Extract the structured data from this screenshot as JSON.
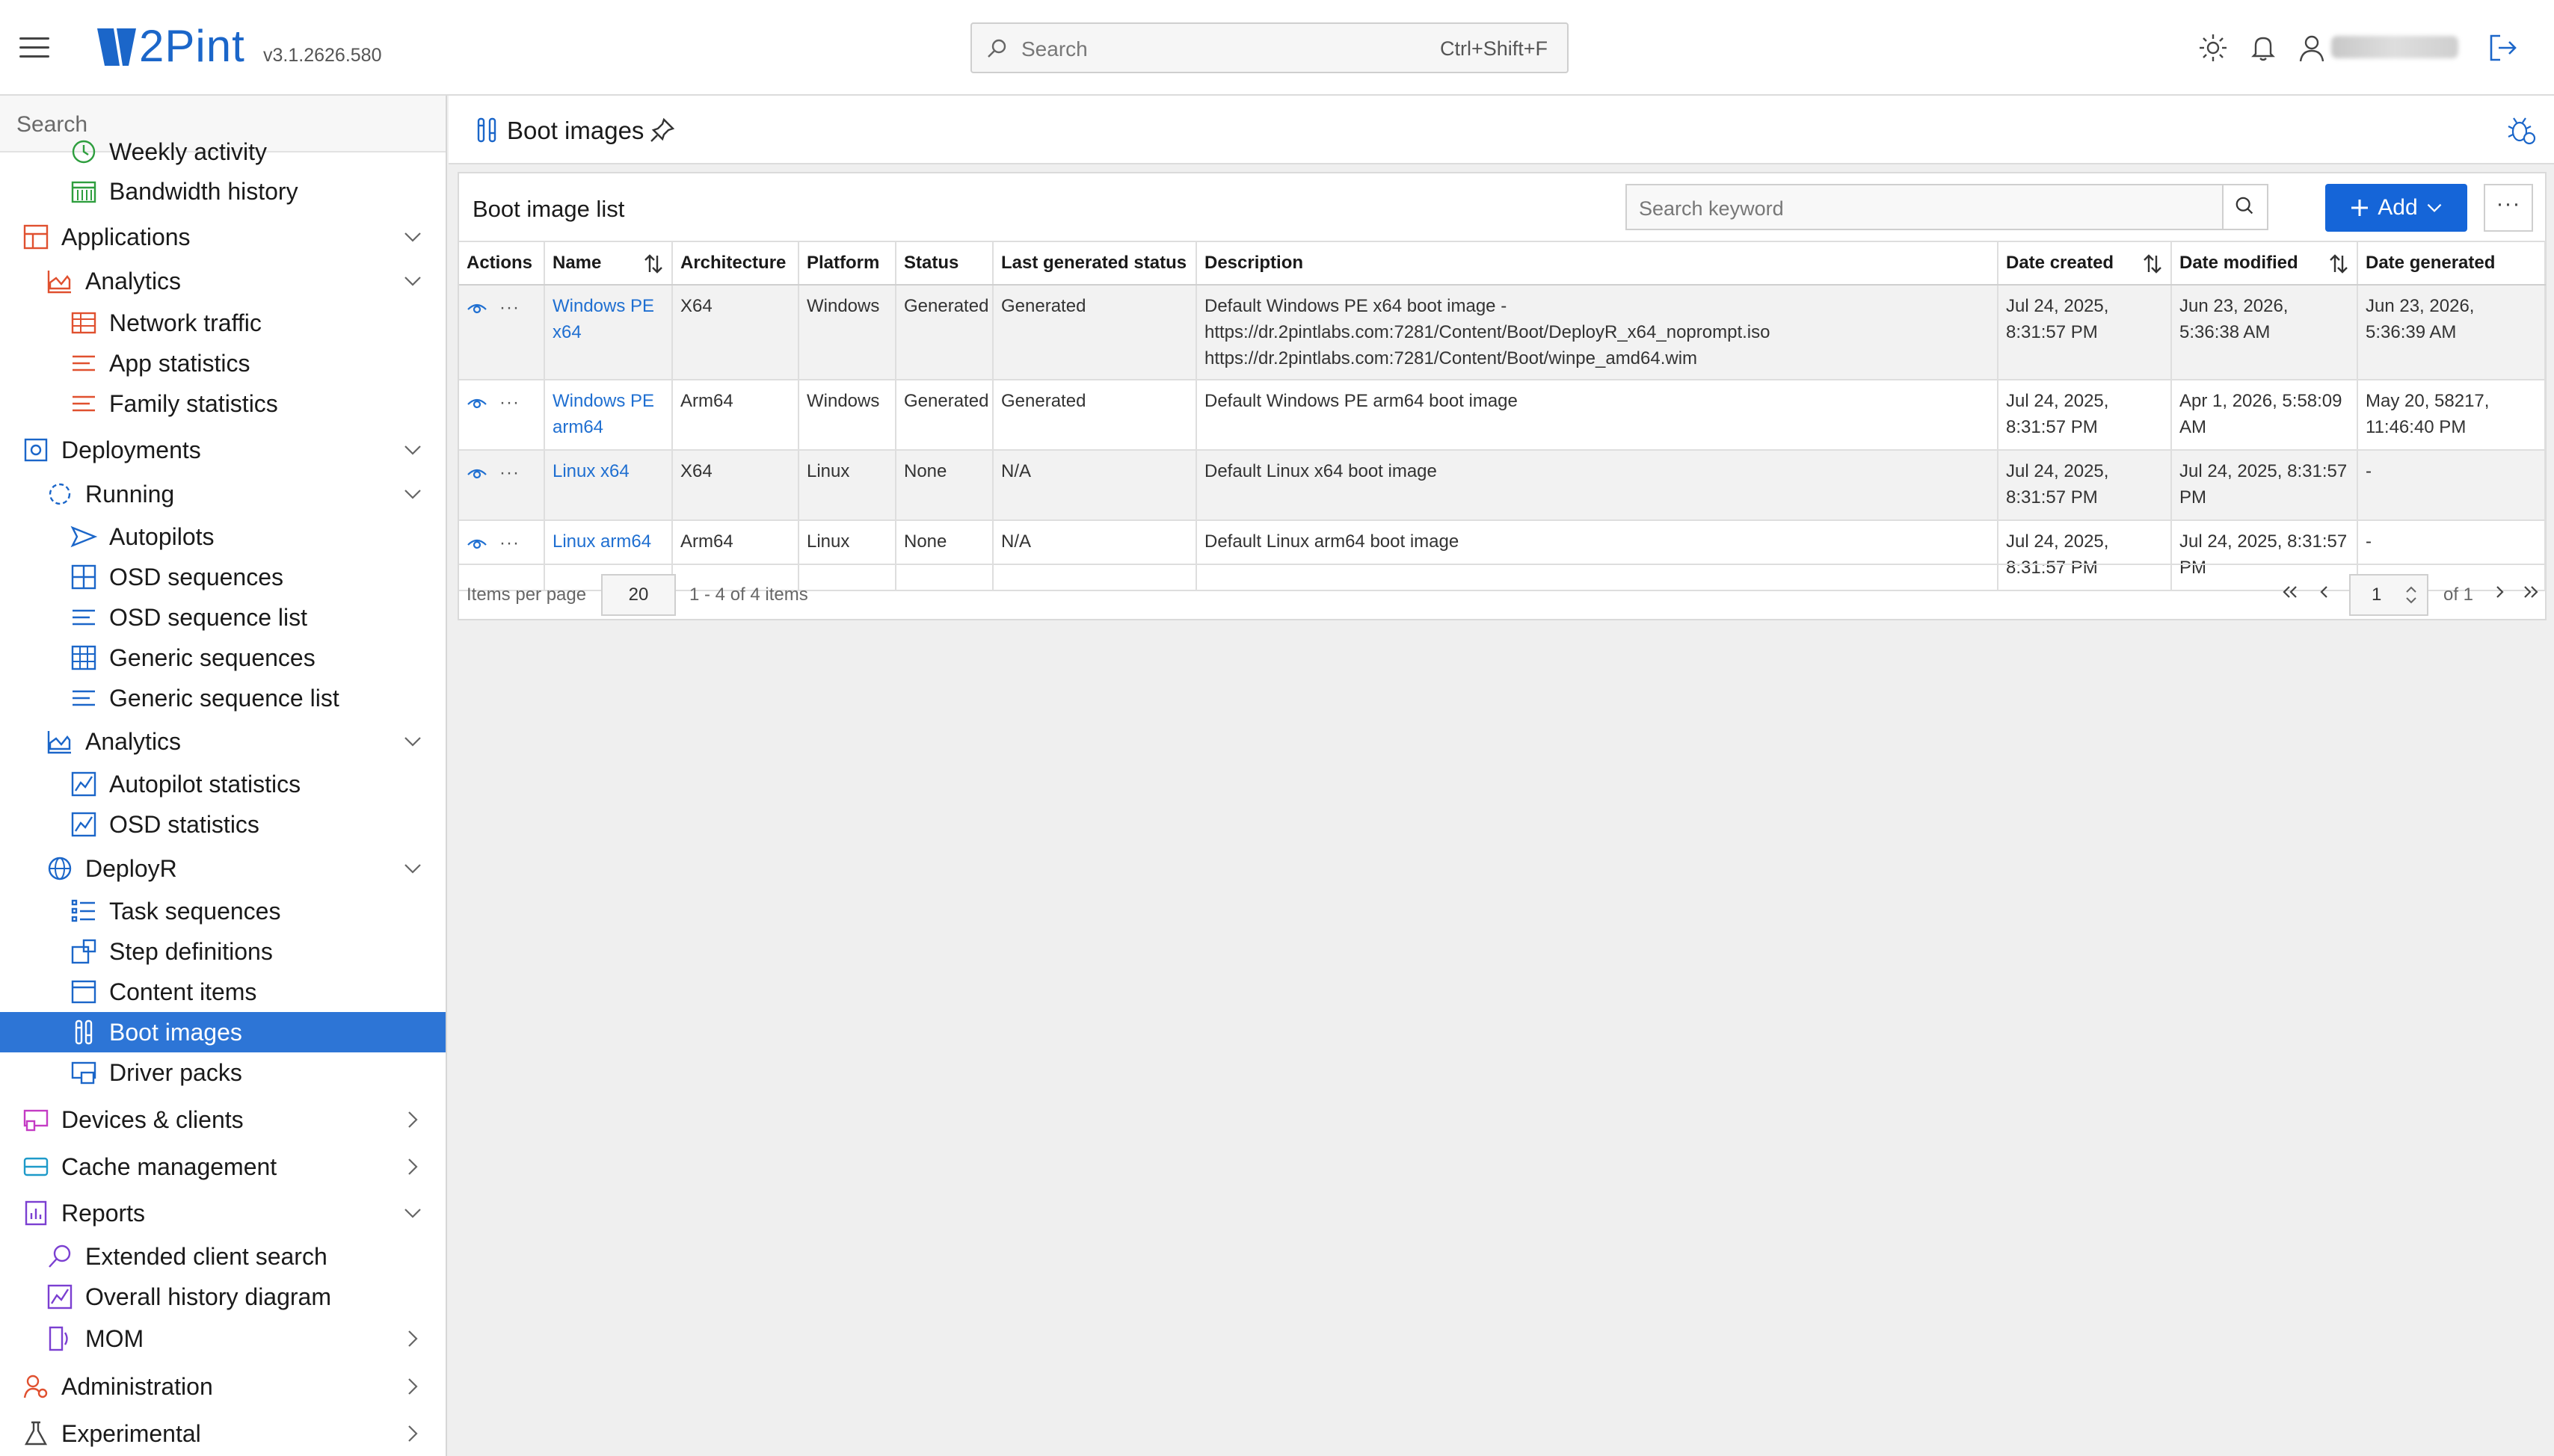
{
  "app": {
    "logo_text": "2Pint",
    "version": "v3.1.2626.580",
    "search_placeholder": "Search",
    "search_shortcut": "Ctrl+Shift+F"
  },
  "sidebar": {
    "search_placeholder": "Search",
    "items": [
      {
        "label": "Weekly activity"
      },
      {
        "label": "Bandwidth history"
      },
      {
        "label": "Applications"
      },
      {
        "label": "Analytics"
      },
      {
        "label": "Network traffic"
      },
      {
        "label": "App statistics"
      },
      {
        "label": "Family statistics"
      },
      {
        "label": "Deployments"
      },
      {
        "label": "Running"
      },
      {
        "label": "Autopilots"
      },
      {
        "label": "OSD sequences"
      },
      {
        "label": "OSD sequence list"
      },
      {
        "label": "Generic sequences"
      },
      {
        "label": "Generic sequence list"
      },
      {
        "label": "Analytics"
      },
      {
        "label": "Autopilot statistics"
      },
      {
        "label": "OSD statistics"
      },
      {
        "label": "DeployR"
      },
      {
        "label": "Task sequences"
      },
      {
        "label": "Step definitions"
      },
      {
        "label": "Content items"
      },
      {
        "label": "Boot images"
      },
      {
        "label": "Driver packs"
      },
      {
        "label": "Devices & clients"
      },
      {
        "label": "Cache management"
      },
      {
        "label": "Reports"
      },
      {
        "label": "Extended client search"
      },
      {
        "label": "Overall history diagram"
      },
      {
        "label": "MOM"
      },
      {
        "label": "Administration"
      },
      {
        "label": "Experimental"
      }
    ],
    "active_item": "Boot images"
  },
  "page": {
    "title": "Boot images"
  },
  "list": {
    "title": "Boot image list",
    "search_placeholder": "Search keyword",
    "add_label": "Add",
    "more_label": "···",
    "columns": [
      "Actions",
      "Name",
      "Architecture",
      "Platform",
      "Status",
      "Last generated status",
      "Description",
      "Date created",
      "Date modified",
      "Date generated"
    ],
    "rows": [
      {
        "name": "Windows PE x64",
        "architecture": "X64",
        "platform": "Windows",
        "status": "Generated",
        "last_generated_status": "Generated",
        "description": "Default Windows PE x64 boot image - https://dr.2pintlabs.com:7281/Content/Boot/DeployR_x64_noprompt.iso https://dr.2pintlabs.com:7281/Content/Boot/winpe_amd64.wim",
        "date_created": "Jul 24, 2025, 8:31:57 PM",
        "date_modified": "Jun 23, 2026, 5:36:38 AM",
        "date_generated": "Jun 23, 2026, 5:36:39 AM"
      },
      {
        "name": "Windows PE arm64",
        "architecture": "Arm64",
        "platform": "Windows",
        "status": "Generated",
        "last_generated_status": "Generated",
        "description": "Default Windows PE arm64 boot image",
        "date_created": "Jul 24, 2025, 8:31:57 PM",
        "date_modified": "Apr 1, 2026, 5:58:09 AM",
        "date_generated": "May 20, 58217, 11:46:40 PM"
      },
      {
        "name": "Linux x64",
        "architecture": "X64",
        "platform": "Linux",
        "status": "None",
        "last_generated_status": "N/A",
        "description": "Default Linux x64 boot image",
        "date_created": "Jul 24, 2025, 8:31:57 PM",
        "date_modified": "Jul 24, 2025, 8:31:57 PM",
        "date_generated": "-"
      },
      {
        "name": "Linux arm64",
        "architecture": "Arm64",
        "platform": "Linux",
        "status": "None",
        "last_generated_status": "N/A",
        "description": "Default Linux arm64 boot image",
        "date_created": "Jul 24, 2025, 8:31:57 PM",
        "date_modified": "Jul 24, 2025, 8:31:57 PM",
        "date_generated": "-"
      }
    ],
    "actions_dots": "···",
    "pager": {
      "items_per_page_label": "Items per page",
      "items_per_page": "20",
      "range": "1 - 4 of 4 items",
      "current_page": "1",
      "of_pages": "of 1"
    }
  },
  "colors": {
    "brand": "#1b66c9",
    "active_nav": "#2d75d6",
    "primary_button": "#1565d8",
    "link": "#1f6fd1"
  }
}
